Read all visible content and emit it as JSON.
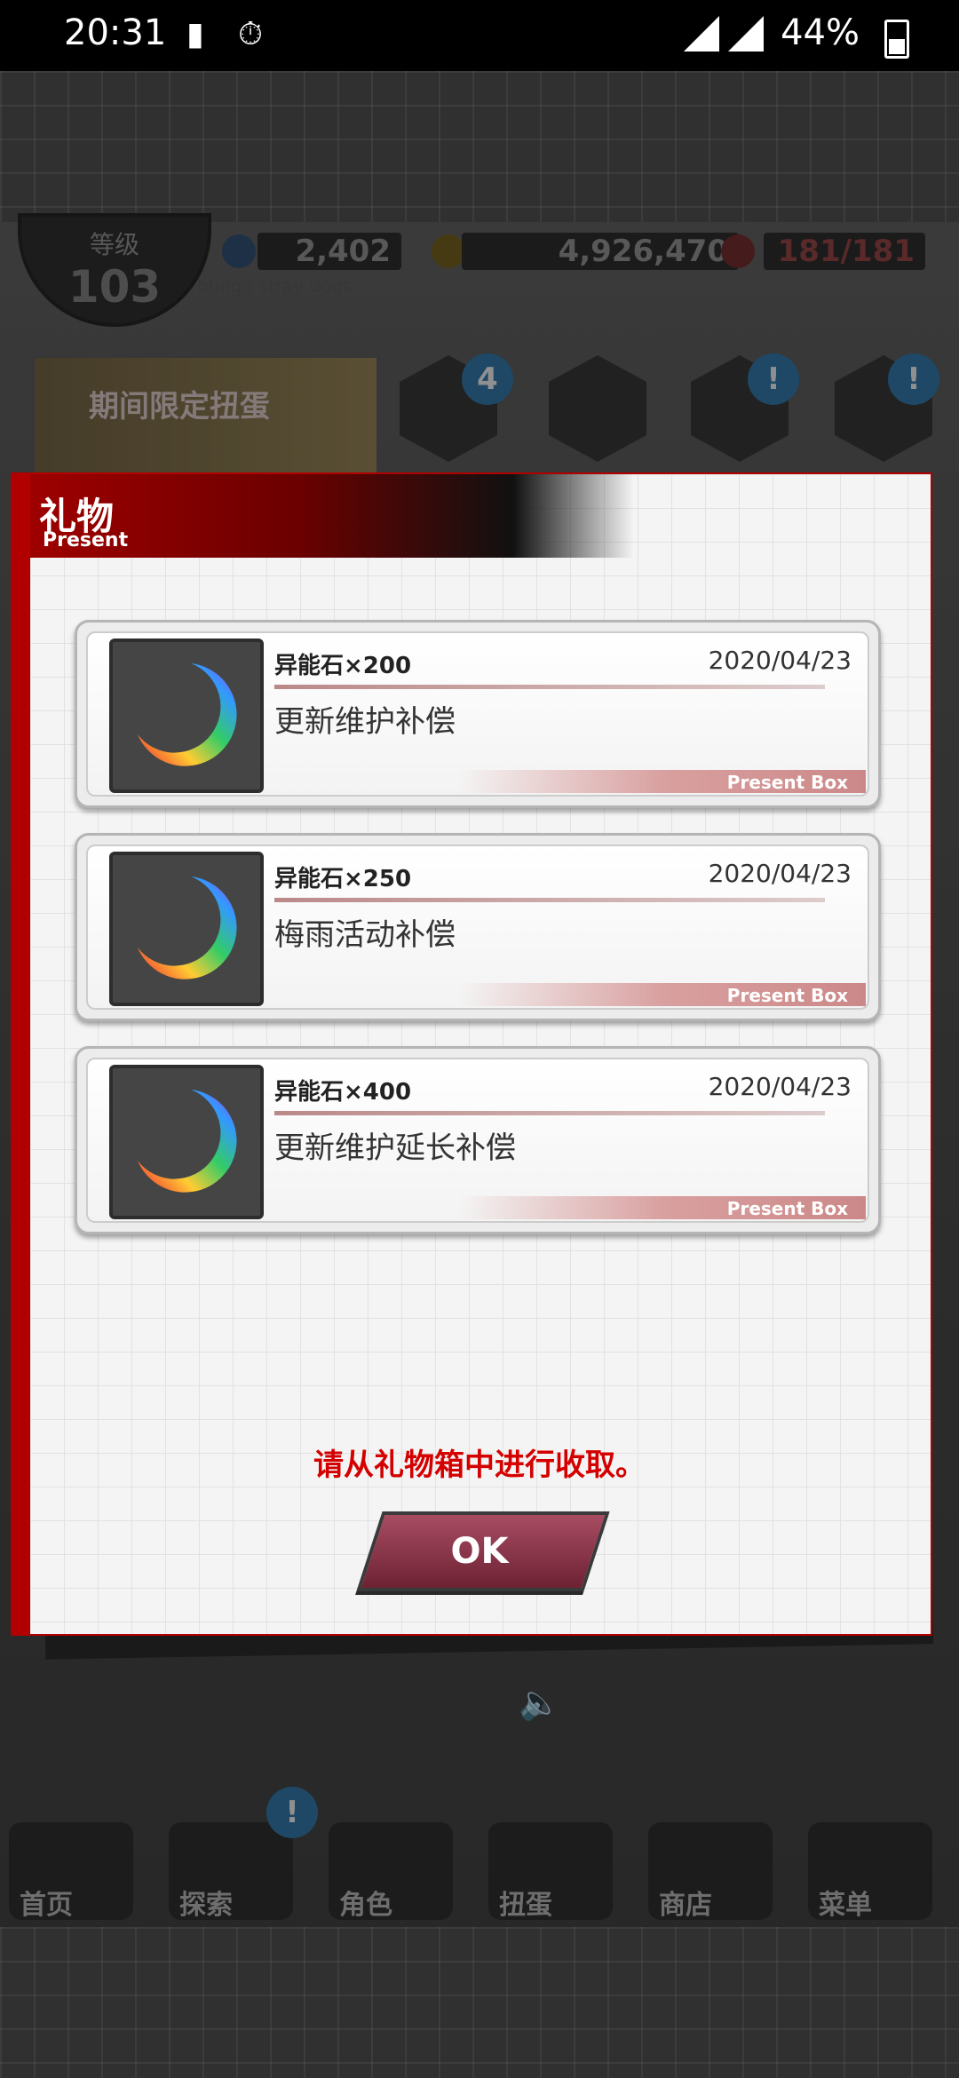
{
  "status_bar": {
    "time": "20:31",
    "battery_percent": "44%",
    "icons": [
      "battery-charging-icon",
      "stopwatch-icon",
      "signal-icon",
      "signal-x-icon",
      "battery-icon"
    ]
  },
  "header": {
    "level_label": "等级",
    "level_value": "103",
    "gems": "2,402",
    "coins": "4,926,470",
    "stamina": "181/181",
    "game_name": "bungo stray dogs"
  },
  "banner": {
    "text": "期间限定扭蛋"
  },
  "menu_badges": {
    "gift_count": "4",
    "alert": "!"
  },
  "dialog": {
    "title": "礼物",
    "subtitle": "Present",
    "items": [
      {
        "name": "异能石×200",
        "date": "2020/04/23",
        "description": "更新维护补偿",
        "source": "Present Box"
      },
      {
        "name": "异能石×250",
        "date": "2020/04/23",
        "description": "梅雨活动补偿",
        "source": "Present Box"
      },
      {
        "name": "异能石×400",
        "date": "2020/04/23",
        "description": "更新维护延长补偿",
        "source": "Present Box"
      }
    ],
    "notice": "请从礼物箱中进行收取。",
    "ok_label": "OK"
  },
  "bottom_nav": [
    {
      "label": "首页",
      "icon": "home-icon"
    },
    {
      "label": "探索",
      "icon": "explore-icon"
    },
    {
      "label": "角色",
      "icon": "characters-icon"
    },
    {
      "label": "扭蛋",
      "icon": "gacha-icon"
    },
    {
      "label": "商店",
      "icon": "shop-icon"
    },
    {
      "label": "菜单",
      "icon": "gear-icon"
    }
  ],
  "colors": {
    "accent_red": "#b00000",
    "ok_button": "#8a3146",
    "notice_red": "#d40000"
  }
}
